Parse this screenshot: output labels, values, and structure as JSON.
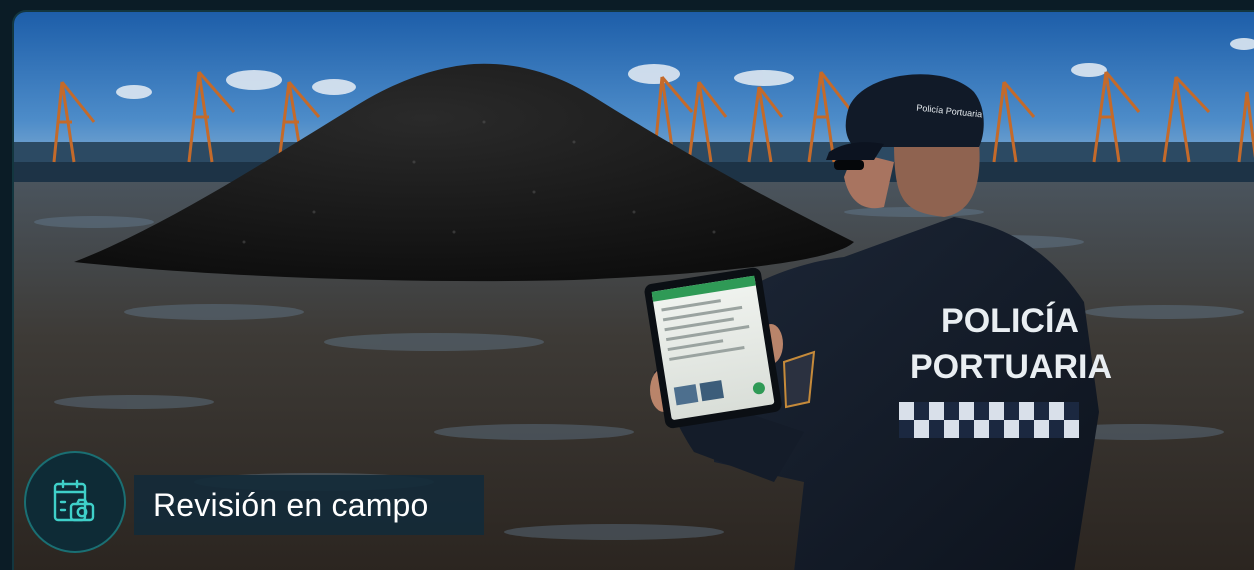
{
  "caption": {
    "label": "Revisión en campo"
  },
  "badge": {
    "icon": "clipboard-camera-icon"
  },
  "officer": {
    "vest_line1": "POLICÍA",
    "vest_line2": "PORTUARIA",
    "cap_text": "Policía Portuaria"
  },
  "colors": {
    "accent": "#1a6f73",
    "caption_bg": "#142a38",
    "sky": "#1f5fa8",
    "coal": "#151515"
  }
}
